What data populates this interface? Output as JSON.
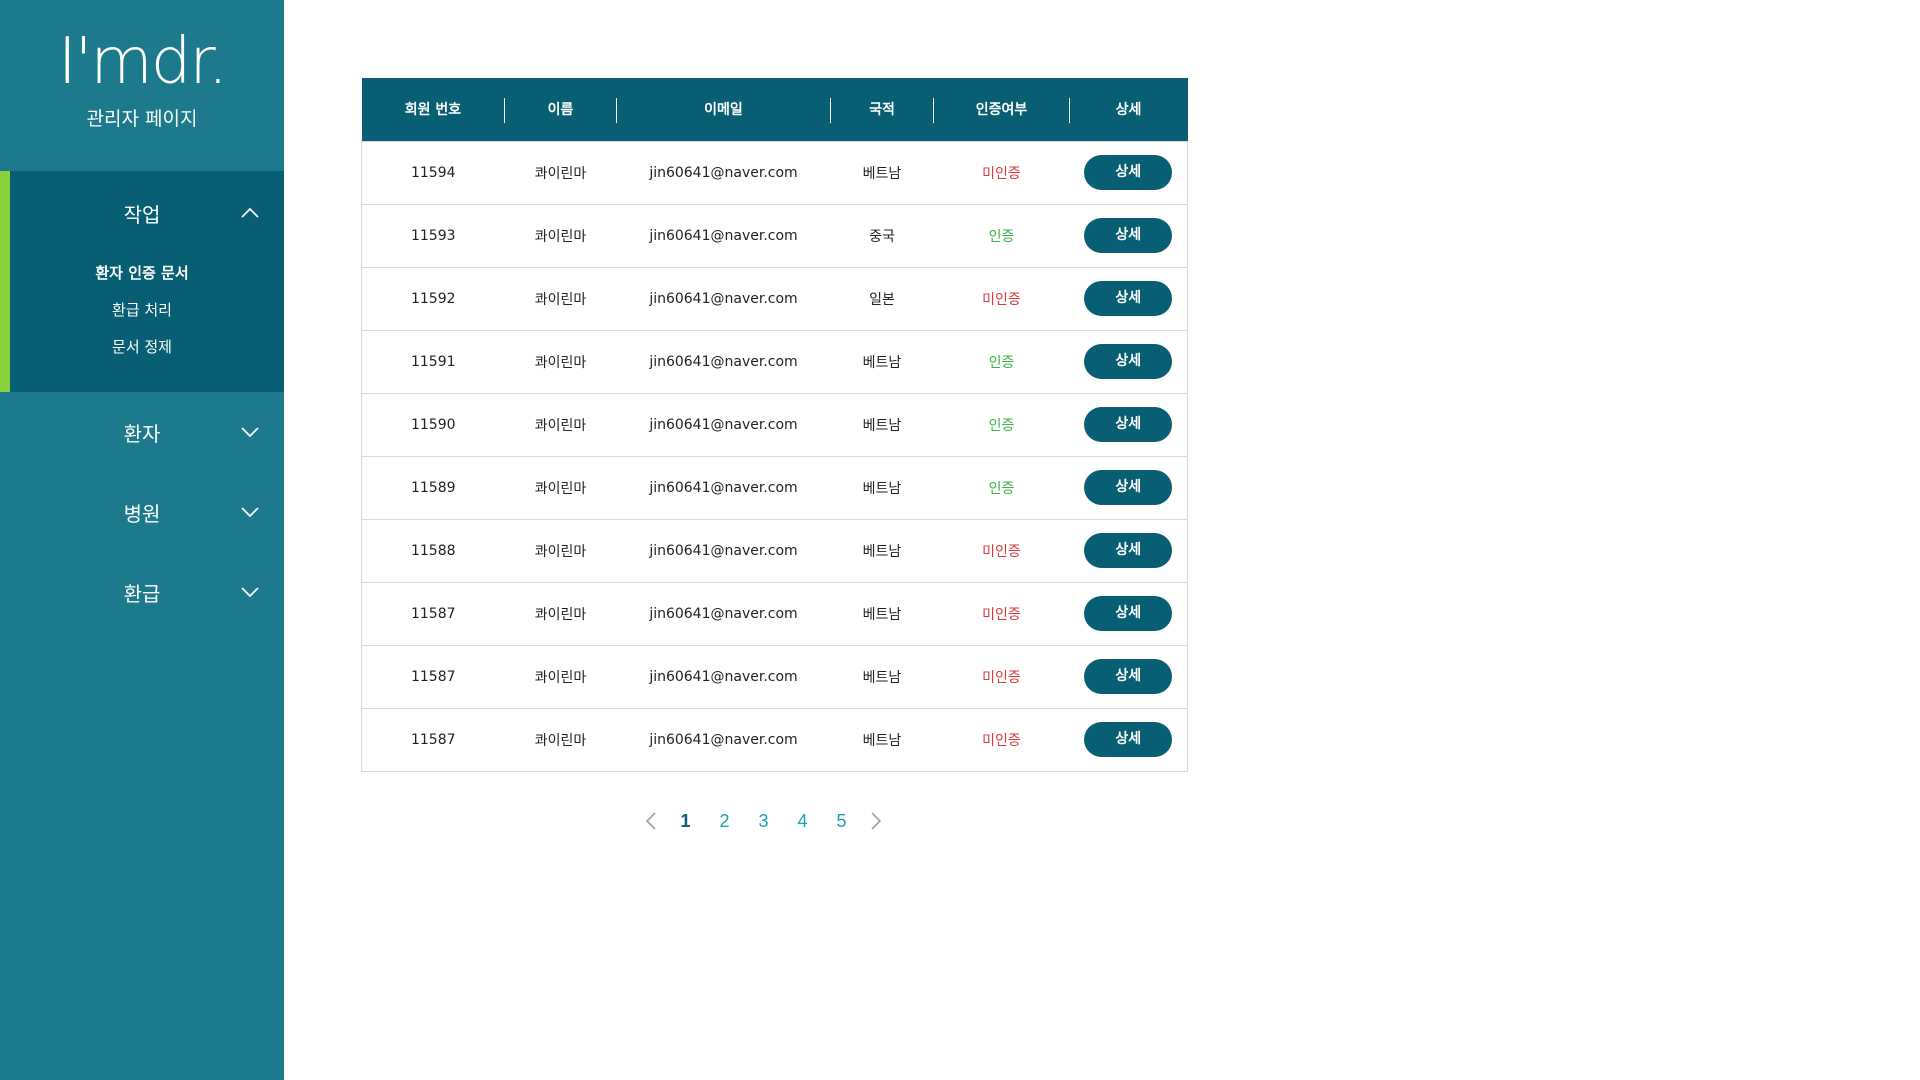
{
  "brand": {
    "logo": "I'mdr.",
    "subtitle": "관리자 페이지"
  },
  "sidebar": {
    "groups": [
      {
        "label": "작업",
        "expanded": true,
        "items": [
          {
            "label": "환자 인증 문서",
            "active": true
          },
          {
            "label": "환급 처리",
            "active": false
          },
          {
            "label": "문서 정제",
            "active": false
          }
        ]
      },
      {
        "label": "환자",
        "expanded": false
      },
      {
        "label": "병원",
        "expanded": false
      },
      {
        "label": "환급",
        "expanded": false
      }
    ]
  },
  "table": {
    "columns": [
      "회원 번호",
      "이름",
      "이메일",
      "국적",
      "인증여부",
      "상세"
    ],
    "detail_label": "상세",
    "rows": [
      {
        "id": "11594",
        "name": "콰이린마",
        "email": "jin60641@naver.com",
        "nation": "베트남",
        "status": "미인증",
        "verified": false
      },
      {
        "id": "11593",
        "name": "콰이린마",
        "email": "jin60641@naver.com",
        "nation": "중국",
        "status": "인증",
        "verified": true
      },
      {
        "id": "11592",
        "name": "콰이린마",
        "email": "jin60641@naver.com",
        "nation": "일본",
        "status": "미인증",
        "verified": false
      },
      {
        "id": "11591",
        "name": "콰이린마",
        "email": "jin60641@naver.com",
        "nation": "베트남",
        "status": "인증",
        "verified": true
      },
      {
        "id": "11590",
        "name": "콰이린마",
        "email": "jin60641@naver.com",
        "nation": "베트남",
        "status": "인증",
        "verified": true
      },
      {
        "id": "11589",
        "name": "콰이린마",
        "email": "jin60641@naver.com",
        "nation": "베트남",
        "status": "인증",
        "verified": true
      },
      {
        "id": "11588",
        "name": "콰이린마",
        "email": "jin60641@naver.com",
        "nation": "베트남",
        "status": "미인증",
        "verified": false
      },
      {
        "id": "11587",
        "name": "콰이린마",
        "email": "jin60641@naver.com",
        "nation": "베트남",
        "status": "미인증",
        "verified": false
      },
      {
        "id": "11587",
        "name": "콰이린마",
        "email": "jin60641@naver.com",
        "nation": "베트남",
        "status": "미인증",
        "verified": false
      },
      {
        "id": "11587",
        "name": "콰이린마",
        "email": "jin60641@naver.com",
        "nation": "베트남",
        "status": "미인증",
        "verified": false
      }
    ]
  },
  "pagination": {
    "pages": [
      "1",
      "2",
      "3",
      "4",
      "5"
    ],
    "current": "1",
    "prev_icon": "chevron-left-icon",
    "next_icon": "chevron-right-icon"
  },
  "colors": {
    "sidebar": "#1c7a8c",
    "sidebar_active": "#085e73",
    "accent_bar": "#8bd13a",
    "header": "#085e73",
    "verified": "#3cb44a",
    "unverified": "#d93a3a",
    "page_link": "#1aa0b0"
  }
}
